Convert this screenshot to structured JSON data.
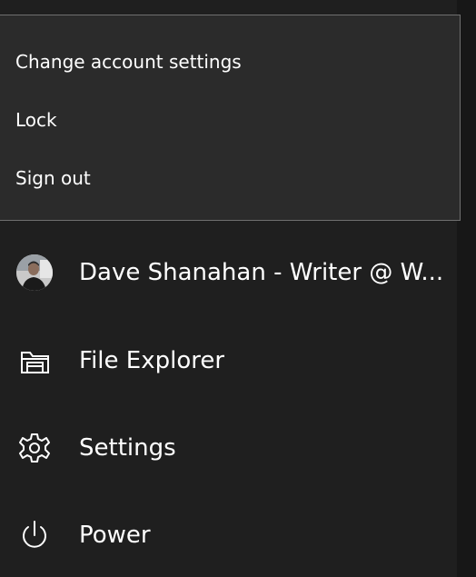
{
  "account_menu": {
    "items": [
      {
        "label": "Change account settings"
      },
      {
        "label": "Lock"
      },
      {
        "label": "Sign out"
      }
    ]
  },
  "start_menu": {
    "user": {
      "label": "Dave Shanahan - Writer @ W..."
    },
    "file_explorer": {
      "label": "File Explorer",
      "icon": "folder-icon"
    },
    "settings": {
      "label": "Settings",
      "icon": "gear-icon"
    },
    "power": {
      "label": "Power",
      "icon": "power-icon"
    }
  },
  "colors": {
    "background": "#1f1f1f",
    "flyout_background": "#2b2b2b",
    "flyout_border": "#6f6f6f",
    "text": "#ffffff"
  }
}
